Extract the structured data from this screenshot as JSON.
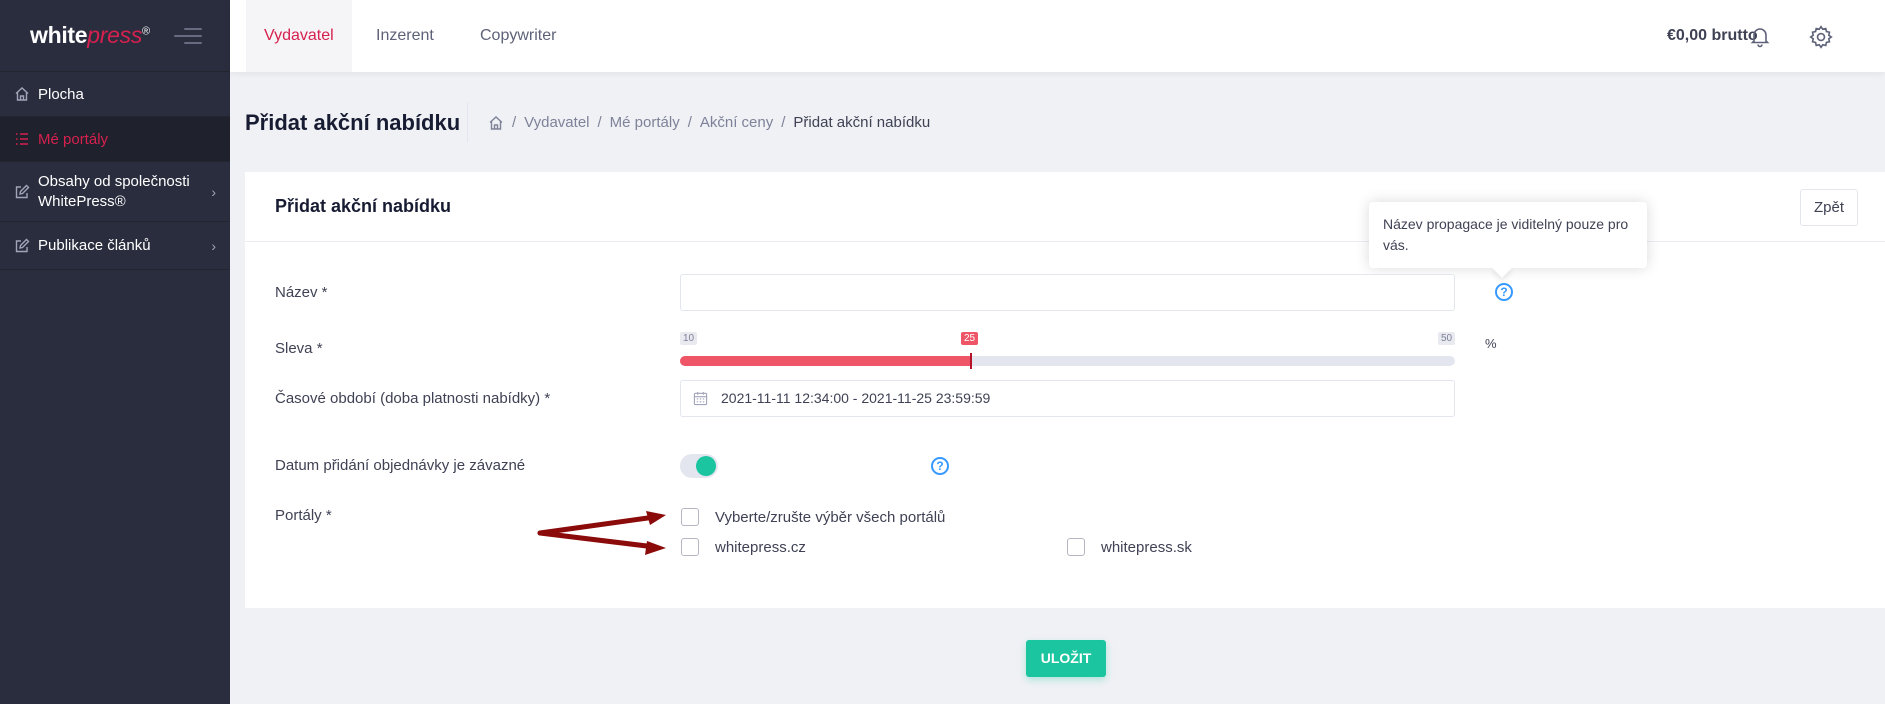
{
  "brand": {
    "name_white": "white",
    "name_press": "press",
    "registered": "®"
  },
  "sidebar": {
    "items": [
      {
        "label": "Plocha",
        "icon": "home-icon"
      },
      {
        "label": "Mé portály",
        "icon": "list-icon",
        "active": true
      },
      {
        "label": "Obsahy od společnosti WhitePress®",
        "icon": "edit-icon",
        "has_submenu": true
      },
      {
        "label": "Publikace článků",
        "icon": "edit-icon",
        "has_submenu": true
      }
    ]
  },
  "topbar": {
    "tabs": [
      {
        "label": "Vydavatel",
        "active": true
      },
      {
        "label": "Inzerent"
      },
      {
        "label": "Copywriter"
      }
    ],
    "balance": "€0,00 brutto"
  },
  "subheader": {
    "title": "Přidat akční nabídku",
    "breadcrumb": [
      "Vydavatel",
      "Mé portály",
      "Akční ceny",
      "Přidat akční nabídku"
    ]
  },
  "card": {
    "title": "Přidat akční nabídku",
    "back_label": "Zpět",
    "tooltip": "Název propagace je viditelný pouze pro vás.",
    "form": {
      "name_label": "Název *",
      "name_value": "",
      "discount_label": "Sleva *",
      "discount_min": "10",
      "discount_max": "50",
      "discount_value": "25",
      "discount_unit": "%",
      "period_label": "Časové období (doba platnosti nabídky) *",
      "period_value": "2021-11-11 12:34:00 - 2021-11-25 23:59:59",
      "binding_label": "Datum přidání objednávky je závazné",
      "binding_on": true,
      "portals_label": "Portály *",
      "select_all_label": "Vyberte/zrušte výběr všech portálů",
      "portals": [
        "whitepress.cz",
        "whitepress.sk"
      ]
    }
  },
  "save_label": "ULOŽIT",
  "colors": {
    "accent": "#d6204e",
    "success": "#1bc5a0",
    "slider": "#ee5566",
    "info": "#3699ff",
    "sidebar": "#2a2d3e"
  }
}
